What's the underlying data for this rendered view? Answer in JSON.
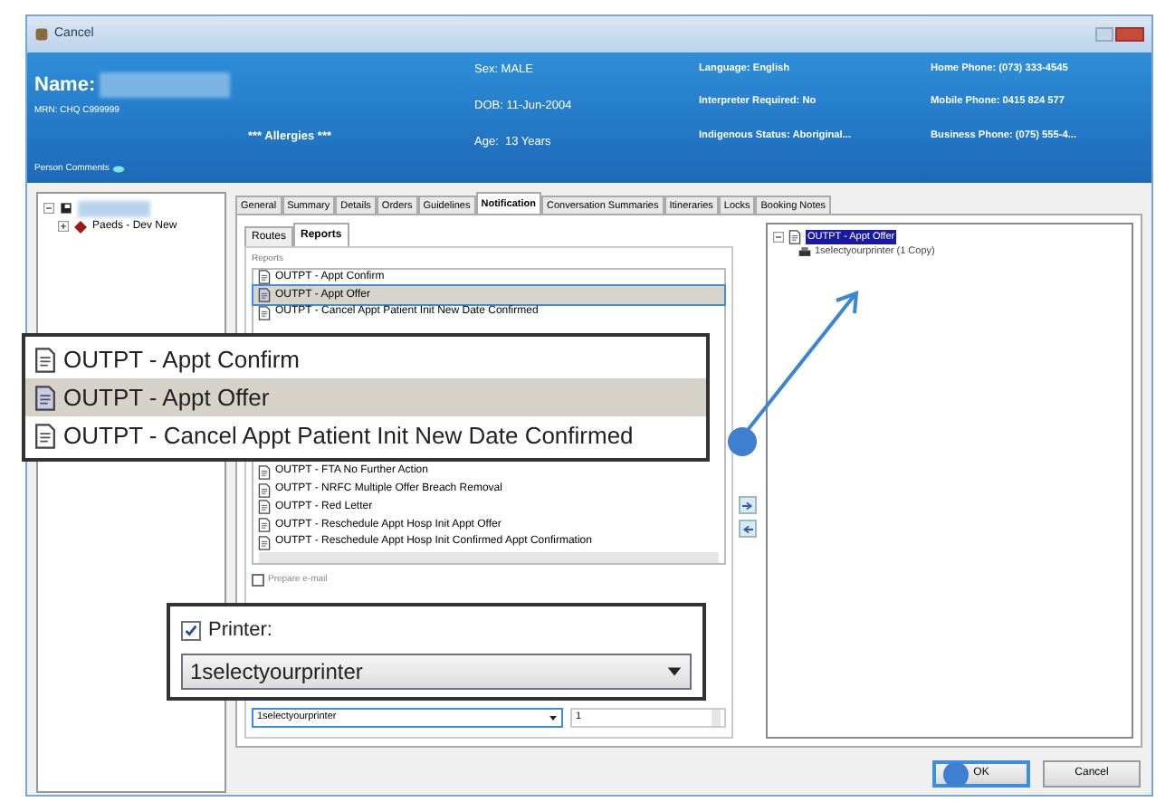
{
  "window": {
    "title": "Cancel"
  },
  "header": {
    "name_label": "Name:",
    "mrn": "MRN: CHQ C999999",
    "allergies": "*** Allergies ***",
    "person_comments": "Person Comments",
    "columns": [
      [
        "Sex: MALE",
        "DOB: 11-Jun-2004",
        "Age:  13 Years"
      ],
      [
        "Language: English",
        "Interpreter Required: No",
        "Indigenous Status: Aboriginal..."
      ],
      [
        "Home Phone: (073) 333-4545",
        "Mobile Phone: 0415 824 577",
        "Business Phone: (075) 555-4..."
      ]
    ]
  },
  "tree": {
    "items": [
      {
        "kind": "redacted",
        "expanded": true,
        "children": [
          {
            "label": "Paeds - Dev New",
            "expanded": false
          }
        ]
      }
    ]
  },
  "tabs": [
    {
      "label": "General",
      "selected": false
    },
    {
      "label": "Summary",
      "selected": false
    },
    {
      "label": "Details",
      "selected": false
    },
    {
      "label": "Orders",
      "selected": false
    },
    {
      "label": "Guidelines",
      "selected": false
    },
    {
      "label": "Notification",
      "selected": true
    },
    {
      "label": "Conversation Summaries",
      "selected": false
    },
    {
      "label": "Itineraries",
      "selected": false
    },
    {
      "label": "Locks",
      "selected": false
    },
    {
      "label": "Booking Notes",
      "selected": false
    }
  ],
  "subtabs": [
    {
      "label": "Routes",
      "selected": false
    },
    {
      "label": "Reports",
      "selected": true
    }
  ],
  "reports": {
    "label": "Reports",
    "items_top": [
      {
        "label": "OUTPT - Appt Confirm",
        "selected": false
      },
      {
        "label": "OUTPT - Appt Offer",
        "selected": true
      },
      {
        "label": "OUTPT - Cancel Appt Patient Init New Date Confirmed",
        "selected": false
      }
    ],
    "items_bottom": [
      {
        "label": "OUTPT - FTA No Further Action",
        "selected": false
      },
      {
        "label": "OUTPT - NRFC Multiple Offer Breach Removal",
        "selected": false
      },
      {
        "label": "OUTPT - Red Letter",
        "selected": false
      },
      {
        "label": "OUTPT - Reschedule Appt Hosp Init Appt Offer",
        "selected": false
      },
      {
        "label": "OUTPT - Reschedule Appt Hosp Init Confirmed Appt Confirmation",
        "selected": false
      }
    ],
    "prepare_email": {
      "label": "Prepare e-mail",
      "checked": false
    },
    "printer": {
      "value": "1selectyourprinter",
      "copies": "1"
    }
  },
  "output_tree": {
    "items": [
      {
        "label": "OUTPT - Appt Offer",
        "selected": true,
        "expanded": true,
        "children": [
          {
            "label": "1selectyourprinter (1 Copy)"
          }
        ]
      }
    ]
  },
  "buttons": [
    {
      "label": "OK",
      "default": true
    },
    {
      "label": "Cancel",
      "default": false
    }
  ],
  "callouts": [
    {
      "kind": "list",
      "items": [
        {
          "label": "OUTPT - Appt Confirm",
          "selected": false
        },
        {
          "label": "OUTPT - Appt Offer",
          "selected": true
        },
        {
          "label": "OUTPT - Cancel Appt Patient Init New Date Confirmed",
          "selected": false
        }
      ]
    },
    {
      "kind": "printer",
      "label": "Printer:",
      "checked": true,
      "value": "1selectyourprinter"
    }
  ]
}
